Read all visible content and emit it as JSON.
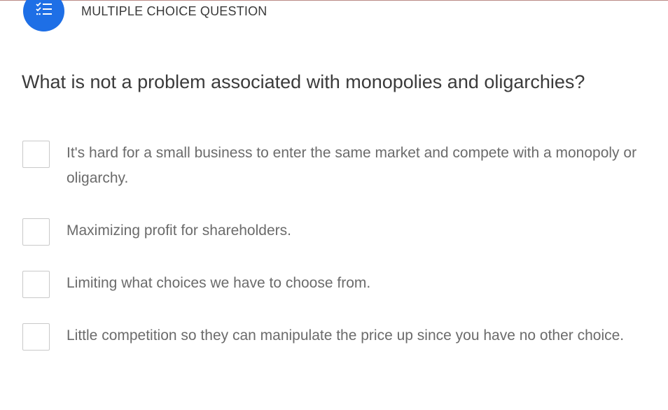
{
  "header": {
    "question_type": "MULTIPLE CHOICE QUESTION",
    "type_icon": "checklist-icon",
    "accent_color": "#1e6fe6"
  },
  "question": {
    "text": "What is not a problem associated with monopolies and oligarchies?"
  },
  "options": [
    {
      "text": "It's hard for a small business to enter the same market and compete with a monopoly or oligarchy.",
      "checked": false
    },
    {
      "text": "Maximizing profit for shareholders.",
      "checked": false
    },
    {
      "text": "Limiting what choices we have to choose from.",
      "checked": false
    },
    {
      "text": "Little competition so they can manipulate the price up since you have no other choice.",
      "checked": false
    }
  ]
}
